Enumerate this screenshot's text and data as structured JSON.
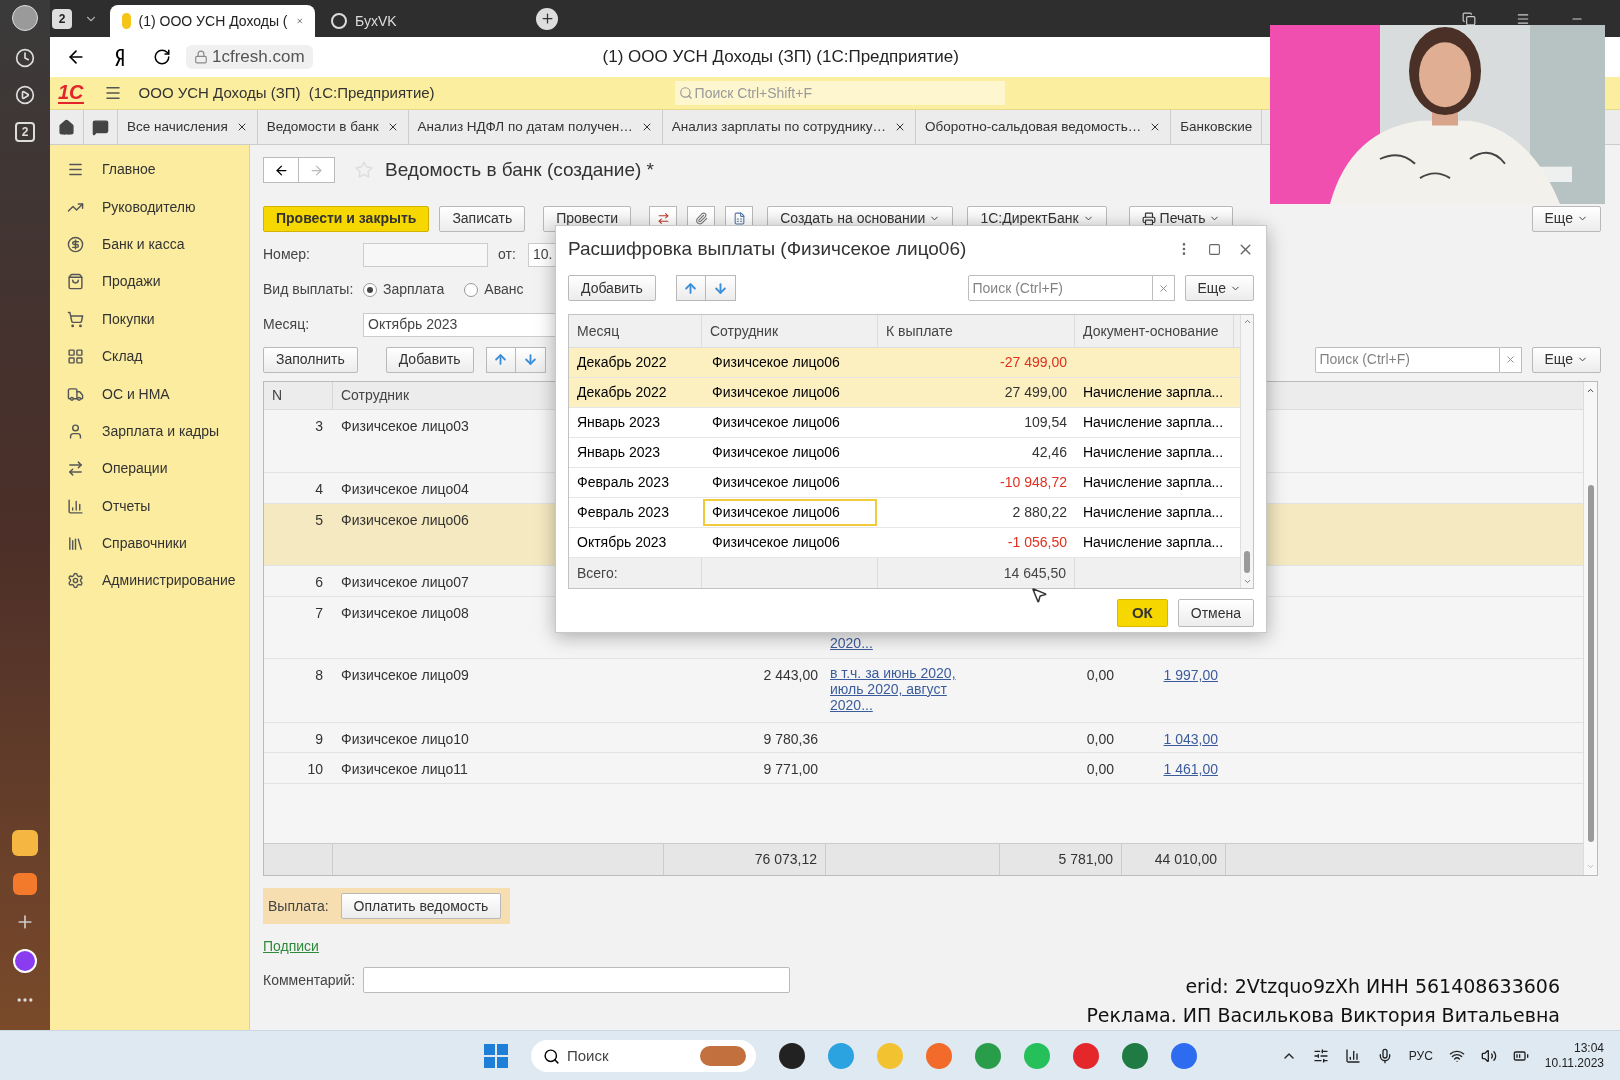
{
  "os_panel": {
    "badge": "2"
  },
  "browser": {
    "workspace_badge": "2",
    "tabs": [
      {
        "label": "(1) ООО УСН Доходы (",
        "selected": true
      },
      {
        "label": "БухVK",
        "selected": false
      }
    ],
    "address": "1cfresh.com",
    "page_title": "(1) ООО УСН Доходы (ЗП) (1С:Предприятие)"
  },
  "app_header": {
    "logo": "1С",
    "title": "ООО УСН Доходы (ЗП)  (1С:Предприятие)",
    "search_placeholder": "Поиск Ctrl+Shift+F"
  },
  "open_tabs": [
    {
      "label": "Все начисления",
      "closable": true
    },
    {
      "label": "Ведомости в банк",
      "closable": true
    },
    {
      "label": "Анализ НДФЛ по датам получен…",
      "closable": true
    },
    {
      "label": "Анализ зарплаты по сотруднику…",
      "closable": true
    },
    {
      "label": "Оборотно-сальдовая ведомость…",
      "closable": true
    },
    {
      "label": "Банковские",
      "closable": false
    }
  ],
  "sidebar": {
    "items": [
      {
        "label": "Главное",
        "kind": "menu"
      },
      {
        "label": "Руководителю",
        "kind": "trend"
      },
      {
        "label": "Банк и касса",
        "kind": "coin"
      },
      {
        "label": "Продажи",
        "kind": "bag"
      },
      {
        "label": "Покупки",
        "kind": "cart"
      },
      {
        "label": "Склад",
        "kind": "grid"
      },
      {
        "label": "ОС и НМА",
        "kind": "truck"
      },
      {
        "label": "Зарплата и кадры",
        "kind": "person"
      },
      {
        "label": "Операции",
        "kind": "transfer"
      },
      {
        "label": "Отчеты",
        "kind": "chart"
      },
      {
        "label": "Справочники",
        "kind": "books"
      },
      {
        "label": "Администрирование",
        "kind": "gear"
      }
    ]
  },
  "document": {
    "title": "Ведомость в банк (создание) *",
    "toolbar": [
      {
        "label": "Провести и закрыть",
        "kind": "primary"
      },
      {
        "label": "Записать",
        "kind": "button"
      },
      {
        "label": "Провести",
        "kind": "button"
      },
      {
        "kind": "transfer"
      },
      {
        "kind": "clip"
      },
      {
        "kind": "report"
      },
      {
        "label": "Создать на основании",
        "kind": "dropdown"
      },
      {
        "label": "1С:ДиректБанк",
        "kind": "dropdown"
      },
      {
        "label": "Печать",
        "kind": "print"
      }
    ],
    "more_top": "Еще",
    "number_label": "Номер:",
    "date_label": "от:",
    "date_value": "10.",
    "payment_type_label": "Вид выплаты:",
    "payment_types": [
      {
        "label": "Зарплата",
        "selected": true
      },
      {
        "label": "Аванс",
        "selected": false
      }
    ],
    "month_label": "Месяц:",
    "month_value": "Октябрь 2023",
    "fill_button": "Заполнить",
    "add_button": "Добавить",
    "search_placeholder": "Поиск (Ctrl+F)",
    "more": "Еще",
    "table": {
      "columns": [
        "N",
        "Сотрудник"
      ],
      "rows": [
        {
          "n": "3",
          "name": "Физичсекое лицо03",
          "selected": false
        },
        {
          "n": "4",
          "name": "Физичсекое лицо04",
          "selected": false
        },
        {
          "n": "5",
          "name": "Физичсекое лицо06",
          "selected": true
        },
        {
          "n": "6",
          "name": "Физичсекое лицо07",
          "selected": false
        },
        {
          "n": "7",
          "name": "Физичсекое лицо08",
          "selected": false,
          "basis": "2020..."
        },
        {
          "n": "8",
          "name": "Физичсекое лицо09",
          "selected": false,
          "amount": "2 443,00",
          "basis": "в т.ч. за июнь 2020, июль 2020, август 2020...",
          "column_5": "0,00",
          "column_6": "1 997,00"
        },
        {
          "n": "9",
          "name": "Физичсекое лицо10",
          "selected": false,
          "amount": "9 780,36",
          "column_5": "0,00",
          "column_6": "1 043,00"
        },
        {
          "n": "10",
          "name": "Физичсекое лицо11",
          "selected": false,
          "amount": "9 771,00",
          "column_5": "0,00",
          "column_6": "1 461,00"
        }
      ],
      "totals": {
        "amount": "76 073,12",
        "column_5": "5 781,00",
        "column_6": "44 010,00"
      }
    },
    "payout_label": "Выплата:",
    "pay_button": "Оплатить ведомость",
    "signatures_link": "Подписи",
    "comment_label": "Комментарий:"
  },
  "dialog": {
    "title": "Расшифровка выплаты (Физичсекое лицо06)",
    "add_button": "Добавить",
    "search_placeholder": "Поиск (Ctrl+F)",
    "more": "Еще",
    "columns": [
      "Месяц",
      "Сотрудник",
      "К выплате",
      "Документ-основание"
    ],
    "rows": [
      {
        "month": "Декабрь 2022",
        "employee": "Физичсекое лицо06",
        "amount": "-27 499,00",
        "negative": true,
        "selected": true,
        "focused": false
      },
      {
        "month": "Декабрь 2022",
        "employee": "Физичсекое лицо06",
        "amount": "27 499,00",
        "negative": false,
        "basis": "Начисление зарпла...",
        "selected": true,
        "focused": false
      },
      {
        "month": "Январь 2023",
        "employee": "Физичсекое лицо06",
        "amount": "109,54",
        "negative": false,
        "basis": "Начисление зарпла...",
        "selected": false,
        "focused": false
      },
      {
        "month": "Январь 2023",
        "employee": "Физичсекое лицо06",
        "amount": "42,46",
        "negative": false,
        "basis": "Начисление зарпла...",
        "selected": false,
        "focused": false
      },
      {
        "month": "Февраль 2023",
        "employee": "Физичсекое лицо06",
        "amount": "-10 948,72",
        "negative": true,
        "basis": "Начисление зарпла...",
        "selected": false,
        "focused": false
      },
      {
        "month": "Февраль 2023",
        "employee": "Физичсекое лицо06",
        "amount": "2 880,22",
        "negative": false,
        "basis": "Начисление зарпла...",
        "selected": false,
        "focused": true
      },
      {
        "month": "Октябрь 2023",
        "employee": "Физичсекое лицо06",
        "amount": "-1 056,50",
        "negative": true,
        "basis": "Начисление зарпла...",
        "selected": false,
        "focused": false
      }
    ],
    "total_label": "Всего:",
    "total": "14 645,50",
    "ok": "ОК",
    "cancel": "Отмена"
  },
  "ad": {
    "line_1": "erid: 2Vtzquo9zXh ИНН 561408633606",
    "line_2": "Реклама. ИП Василькова Виктория Витальевна"
  },
  "taskbar": {
    "search_placeholder": "Поиск",
    "language": "РУС",
    "time": "13:04",
    "date": "10.11.2023"
  }
}
